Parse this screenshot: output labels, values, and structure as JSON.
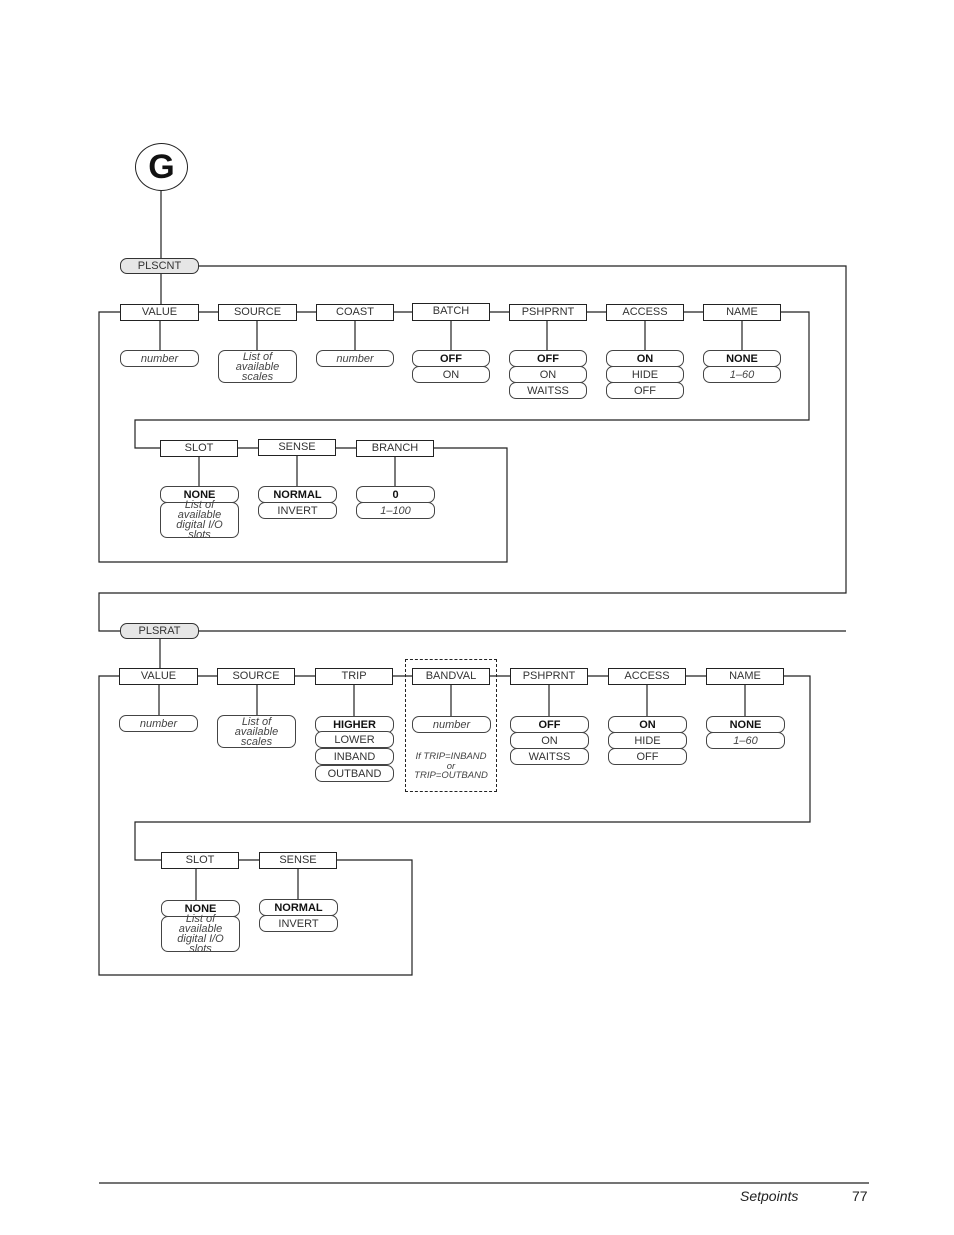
{
  "diagram": {
    "entry_marker": "G",
    "branches": [
      {
        "root": "PLSCNT",
        "rows": [
          [
            {
              "label": "VALUE",
              "options": [
                {
                  "text": "number",
                  "style": "italic"
                }
              ]
            },
            {
              "label": "SOURCE",
              "options": [
                {
                  "text": "List of available scales",
                  "style": "italic"
                }
              ]
            },
            {
              "label": "COAST",
              "options": [
                {
                  "text": "number",
                  "style": "italic"
                }
              ]
            },
            {
              "label": "BATCH",
              "options": [
                {
                  "text": "OFF",
                  "style": "default"
                },
                {
                  "text": "ON",
                  "style": "normal"
                }
              ]
            },
            {
              "label": "PSHPRNT",
              "options": [
                {
                  "text": "OFF",
                  "style": "default"
                },
                {
                  "text": "ON",
                  "style": "normal"
                },
                {
                  "text": "WAITSS",
                  "style": "normal"
                }
              ]
            },
            {
              "label": "ACCESS",
              "options": [
                {
                  "text": "ON",
                  "style": "default"
                },
                {
                  "text": "HIDE",
                  "style": "normal"
                },
                {
                  "text": "OFF",
                  "style": "normal"
                }
              ]
            },
            {
              "label": "NAME",
              "options": [
                {
                  "text": "NONE",
                  "style": "default"
                },
                {
                  "text": "1–60",
                  "style": "italic"
                }
              ]
            }
          ],
          [
            {
              "label": "SLOT",
              "options": [
                {
                  "text": "NONE",
                  "style": "default"
                },
                {
                  "text": "List of available digital I/O slots",
                  "style": "italic"
                }
              ]
            },
            {
              "label": "SENSE",
              "options": [
                {
                  "text": "NORMAL",
                  "style": "default"
                },
                {
                  "text": "INVERT",
                  "style": "normal"
                }
              ]
            },
            {
              "label": "BRANCH",
              "options": [
                {
                  "text": "0",
                  "style": "default"
                },
                {
                  "text": "1–100",
                  "style": "italic"
                }
              ]
            }
          ]
        ]
      },
      {
        "root": "PLSRAT",
        "rows": [
          [
            {
              "label": "VALUE",
              "options": [
                {
                  "text": "number",
                  "style": "italic"
                }
              ]
            },
            {
              "label": "SOURCE",
              "options": [
                {
                  "text": "List of available scales",
                  "style": "italic"
                }
              ]
            },
            {
              "label": "TRIP",
              "options": [
                {
                  "text": "HIGHER",
                  "style": "default"
                },
                {
                  "text": "LOWER",
                  "style": "normal"
                },
                {
                  "text": "INBAND",
                  "style": "normal"
                },
                {
                  "text": "OUTBAND",
                  "style": "normal"
                }
              ]
            },
            {
              "label": "BANDVAL",
              "options": [
                {
                  "text": "number",
                  "style": "italic"
                }
              ],
              "note": "If TRIP=INBAND or TRIP=OUTBAND",
              "conditional": true
            },
            {
              "label": "PSHPRNT",
              "options": [
                {
                  "text": "OFF",
                  "style": "default"
                },
                {
                  "text": "ON",
                  "style": "normal"
                },
                {
                  "text": "WAITSS",
                  "style": "normal"
                }
              ]
            },
            {
              "label": "ACCESS",
              "options": [
                {
                  "text": "ON",
                  "style": "default"
                },
                {
                  "text": "HIDE",
                  "style": "normal"
                },
                {
                  "text": "OFF",
                  "style": "normal"
                }
              ]
            },
            {
              "label": "NAME",
              "options": [
                {
                  "text": "NONE",
                  "style": "default"
                },
                {
                  "text": "1–60",
                  "style": "italic"
                }
              ]
            }
          ],
          [
            {
              "label": "SLOT",
              "options": [
                {
                  "text": "NONE",
                  "style": "default"
                },
                {
                  "text": "List of available digital I/O slots",
                  "style": "italic"
                }
              ]
            },
            {
              "label": "SENSE",
              "options": [
                {
                  "text": "NORMAL",
                  "style": "default"
                },
                {
                  "text": "INVERT",
                  "style": "normal"
                }
              ]
            }
          ]
        ]
      }
    ],
    "bandval_note_lines": [
      "If TRIP=INBAND",
      "or",
      "TRIP=OUTBAND"
    ]
  },
  "footer": {
    "section": "Setpoints",
    "page": "77"
  }
}
